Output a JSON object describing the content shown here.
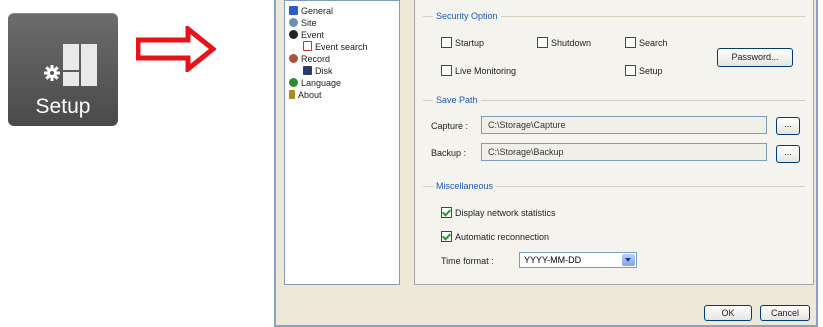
{
  "tile": {
    "label": "Setup",
    "icon": "setup-icon"
  },
  "arrow": {
    "color": "#e8141b"
  },
  "tree": {
    "items": [
      {
        "label": "General",
        "icon": "general-icon",
        "color": "#2d5fc1"
      },
      {
        "label": "Site",
        "icon": "site-icon",
        "color": "#6f8fb2"
      },
      {
        "label": "Event",
        "icon": "event-icon",
        "color": "#222222"
      },
      {
        "label": "Event search",
        "icon": "event-search-icon",
        "color": "#c0392b"
      },
      {
        "label": "Record",
        "icon": "record-icon",
        "color": "#b0503a"
      },
      {
        "label": "Disk",
        "icon": "disk-icon",
        "color": "#2a3b66"
      },
      {
        "label": "Language",
        "icon": "language-icon",
        "color": "#2a8c2a"
      },
      {
        "label": "About",
        "icon": "about-icon",
        "color": "#b08a20"
      }
    ]
  },
  "security": {
    "title": "Security Option",
    "startup": {
      "label": "Startup",
      "checked": false
    },
    "shutdown": {
      "label": "Shutdown",
      "checked": false
    },
    "search": {
      "label": "Search",
      "checked": false
    },
    "live": {
      "label": "Live Monitoring",
      "checked": false
    },
    "setup": {
      "label": "Setup",
      "checked": false
    },
    "password_button": "Password..."
  },
  "save_path": {
    "title": "Save Path",
    "capture_label": "Capture :",
    "capture_value": "C:\\Storage\\Capture",
    "backup_label": "Backup :",
    "backup_value": "C:\\Storage\\Backup",
    "browse_label": "..."
  },
  "misc": {
    "title": "Miscellaneous",
    "network_stats": {
      "label": "Display network statistics",
      "checked": true
    },
    "auto_reconnect": {
      "label": "Automatic reconnection",
      "checked": true
    },
    "time_format_label": "Time format :",
    "time_format_value": "YYYY-MM-DD"
  },
  "footer": {
    "ok": "OK",
    "cancel": "Cancel"
  }
}
